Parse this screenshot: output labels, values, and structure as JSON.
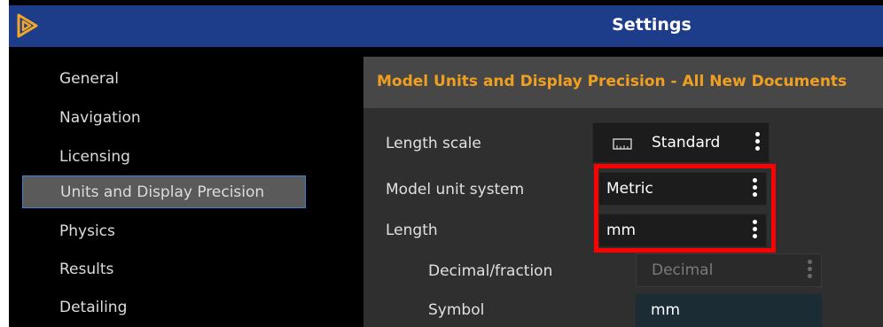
{
  "window": {
    "title": "Settings"
  },
  "sidebar": {
    "items": [
      {
        "label": "General"
      },
      {
        "label": "Navigation"
      },
      {
        "label": "Licensing"
      },
      {
        "label": "Units and Display Precision"
      },
      {
        "label": "Physics"
      },
      {
        "label": "Results"
      },
      {
        "label": "Detailing"
      }
    ],
    "selected": "Units and Display Precision"
  },
  "section": {
    "title": "Model Units and Display Precision - All New Documents"
  },
  "settings": {
    "length_scale": {
      "label": "Length scale",
      "value": "Standard",
      "icon": "ruler-icon"
    },
    "model_unit_system": {
      "label": "Model unit system",
      "value": "Metric"
    },
    "length": {
      "label": "Length",
      "value": "mm"
    },
    "decimal_fraction": {
      "label": "Decimal/fraction",
      "value": "Decimal"
    },
    "symbol": {
      "label": "Symbol",
      "value": "mm"
    }
  },
  "colors": {
    "titlebar": "#1d3d8a",
    "accent_text": "#f0a020",
    "selection_border": "#3f7fd6",
    "highlight": "#ff0000"
  }
}
